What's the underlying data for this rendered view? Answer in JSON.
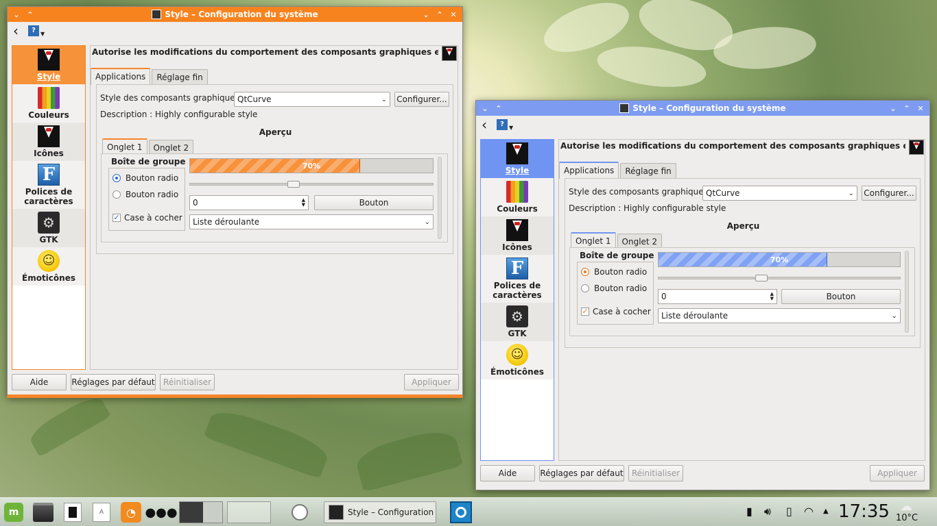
{
  "colors": {
    "window1_title_bg": "#f7831f",
    "window2_title_bg": "#7d9bf1",
    "window1_accent": "#f6852a",
    "window2_accent": "#6f94f2",
    "window1_selected_bg": "#f6923a",
    "window2_selected_bg": "#6f94f2"
  },
  "windows": [
    {
      "title": "Style – Configuration du système",
      "sidebar": [
        {
          "label": "Style",
          "icon": "style-icon"
        },
        {
          "label": "Couleurs",
          "icon": "colors-icon"
        },
        {
          "label": "Icônes",
          "icon": "icons-icon"
        },
        {
          "label": "Polices de caractères",
          "icon": "fonts-icon"
        },
        {
          "label": "GTK",
          "icon": "gtk-icon"
        },
        {
          "label": "Émoticônes",
          "icon": "emoticons-icon"
        }
      ],
      "header": "Autorise les modifications du comportement des composants graphiques et des styles d",
      "tabs": [
        "Applications",
        "Réglage fin"
      ],
      "widget_style_label": "Style des composants graphiques :",
      "widget_style_value": "QtCurve",
      "configure_button": "Configurer...",
      "description": "Description : Highly configurable style",
      "preview_title": "Aperçu",
      "preview_tabs": [
        "Onglet 1",
        "Onglet 2"
      ],
      "groupbox_title": "Boîte de groupe",
      "radio1": "Bouton radio",
      "radio2": "Bouton radio",
      "checkbox": "Case à cocher",
      "progress_text": "70%",
      "progress_value": 0.7,
      "slider_value": 0.4,
      "spin_value": "0",
      "button_label": "Bouton",
      "dropdown_label": "Liste déroulante",
      "bottom": {
        "help": "Aide",
        "defaults": "Réglages par défaut",
        "reset": "Réinitialiser",
        "apply": "Appliquer"
      }
    },
    {
      "title": "Style – Configuration du système",
      "sidebar": [
        {
          "label": "Style",
          "icon": "style-icon"
        },
        {
          "label": "Couleurs",
          "icon": "colors-icon"
        },
        {
          "label": "Icônes",
          "icon": "icons-icon"
        },
        {
          "label": "Polices de caractères",
          "icon": "fonts-icon"
        },
        {
          "label": "GTK",
          "icon": "gtk-icon"
        },
        {
          "label": "Émoticônes",
          "icon": "emoticons-icon"
        }
      ],
      "header": "Autorise les modifications du comportement des composants graphiques et des styles d",
      "tabs": [
        "Applications",
        "Réglage fin"
      ],
      "widget_style_label": "Style des composants graphiques :",
      "widget_style_value": "QtCurve",
      "configure_button": "Configurer...",
      "description": "Description : Highly configurable style",
      "preview_title": "Aperçu",
      "preview_tabs": [
        "Onglet 1",
        "Onglet 2"
      ],
      "groupbox_title": "Boîte de groupe",
      "radio1": "Bouton radio",
      "radio2": "Bouton radio",
      "checkbox": "Case à cocher",
      "progress_text": "70%",
      "progress_value": 0.7,
      "slider_value": 0.4,
      "spin_value": "0",
      "button_label": "Bouton",
      "dropdown_label": "Liste déroulante",
      "bottom": {
        "help": "Aide",
        "defaults": "Réglages par défaut",
        "reset": "Réinitialiser",
        "apply": "Appliquer"
      }
    }
  ],
  "taskbar": {
    "task_title": "Style – Configuration d",
    "clock": "17:35",
    "temperature": "10°C",
    "launcher_letter": "A"
  }
}
